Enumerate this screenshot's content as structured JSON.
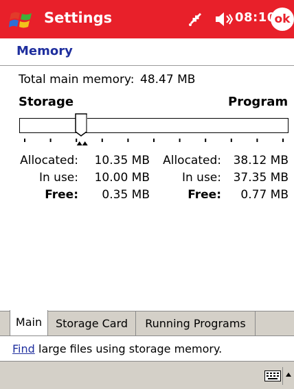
{
  "titlebar": {
    "title": "Settings",
    "time": "08:10",
    "ok_label": "ok",
    "icons": [
      "windows-start-icon",
      "connectivity-icon",
      "speaker-icon"
    ]
  },
  "page": {
    "heading": "Memory"
  },
  "total": {
    "label": "Total main memory:",
    "value": "48.47 MB"
  },
  "slider": {
    "left_label": "Storage",
    "right_label": "Program",
    "storage_fraction": 0.22
  },
  "storage": {
    "allocated_label": "Allocated:",
    "allocated": "10.35 MB",
    "inuse_label": "In use:",
    "inuse": "10.00 MB",
    "free_label": "Free:",
    "free": "0.35 MB"
  },
  "program": {
    "allocated_label": "Allocated:",
    "allocated": "38.12 MB",
    "inuse_label": "In use:",
    "inuse": "37.35 MB",
    "free_label": "Free:",
    "free": "0.77 MB"
  },
  "tabs": [
    {
      "label": "Main",
      "active": true
    },
    {
      "label": "Storage Card",
      "active": false
    },
    {
      "label": "Running Programs",
      "active": false
    }
  ],
  "findbar": {
    "link": "Find",
    "text": "large files using storage memory."
  },
  "colors": {
    "title_red": "#e8202a",
    "heading_blue": "#1f2f9e",
    "bar_gray": "#d4d0c8"
  }
}
